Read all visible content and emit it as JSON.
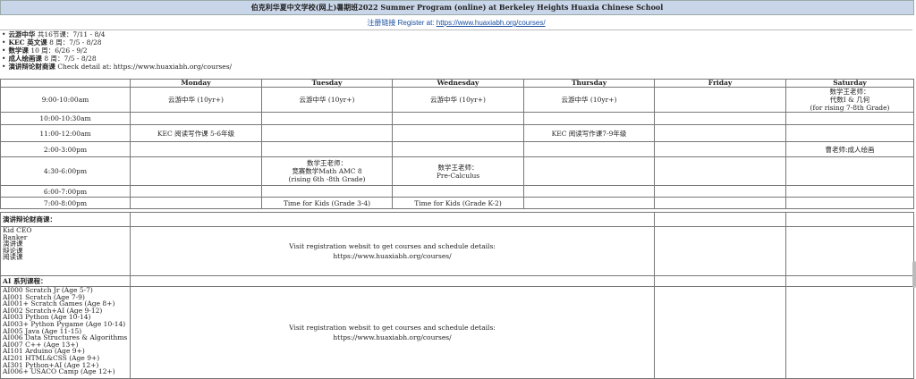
{
  "header": {
    "title": "伯克利华夏中文学校(网上)暑期班2022 Summer Program (online) at Berkeley Heights Huaxia Chinese School"
  },
  "register": {
    "label": "注册链接 Register at: ",
    "url": "https://www.huaxiabh.org/courses/"
  },
  "bullets": [
    {
      "name": "云游中华",
      "rest": " 共16节课：7/11 - 8/4"
    },
    {
      "name": "KEC 英文课",
      "rest": " 8 周：7/5 - 8/28"
    },
    {
      "name": "数学课",
      "rest": " 10 周：6/26 - 9/2"
    },
    {
      "name": "成人绘画课",
      "rest": " 8 周：7/5 - 8/28"
    },
    {
      "name": "演讲辩论财商课",
      "rest": " Check detail at: https://www.huaxiabh.org/courses/"
    }
  ],
  "days": [
    "Monday",
    "Tuesday",
    "Wednesday",
    "Thursday",
    "Friday",
    "Saturday"
  ],
  "schedule": [
    {
      "time": "9:00-10:00am",
      "cells": [
        "云游中华 (10yr+)",
        "云游中华 (10yr+)",
        "云游中华 (10yr+)",
        "云游中华 (10yr+)",
        "",
        "数学王老师：\n代数I & 几何\n(for rising 7-8th Grade)"
      ]
    },
    {
      "time": "10:00-10:30am",
      "cells": [
        "",
        "",
        "",
        "",
        "",
        ""
      ]
    },
    {
      "time": "11:00-12:00am",
      "cells": [
        "KEC 阅读写作课 5-6年级",
        "",
        "",
        "KEC 阅读写作课7-9年级",
        "",
        ""
      ]
    },
    {
      "time": "2:00-3:00pm",
      "cells": [
        "",
        "",
        "",
        "",
        "",
        "曹老师:成人绘画"
      ]
    },
    {
      "time": "4:30-6:00pm",
      "cells": [
        "",
        "数学王老师：\n竞赛数学Math AMC 8\n(rising 6th -8th Grade)",
        "数学王老师：\nPre-Calculus",
        "",
        "",
        ""
      ]
    },
    {
      "time": "6:00-7:00pm",
      "cells": [
        "",
        "",
        "",
        "",
        "",
        ""
      ]
    },
    {
      "time": "7:00-8:00pm",
      "cells": [
        "",
        "Time for Kids (Grade 3-4)",
        "Time for Kids (Grade K-2)",
        "",
        "",
        ""
      ]
    }
  ],
  "speech": {
    "heading": "演讲辩论财商课：",
    "items": [
      "Kid CEO",
      "Banker",
      "演讲课",
      "辩论课",
      "阅读课"
    ],
    "notice_line1": "Visit registration websit to get courses and schedule details:",
    "notice_line2": "https://www.huaxiabh.org/courses/"
  },
  "ai": {
    "heading": "AI 系列课程：",
    "items": [
      "AI000 Scratch Jr (Age 5-7)",
      "AI001 Scratch (Age 7-9)",
      "AI001+ Scratch Games (Age 8+)",
      "AI002 Scratch+AI (Age 9-12)",
      "AI003 Python (Age 10-14)",
      "AI003+ Python Pygame (Age 10-14)",
      "AI005 Java (Age 11-15)",
      "AI006 Data Structures & Algorithms",
      "AI007 C++ (Age 13+)",
      "AI101 Arduino (Age 9+)",
      "AI201 HTML&CSS (Age 9+)",
      "AI301 Python+AI (Age 12+)",
      "AI006+ USACO Camp (Age 12+)"
    ],
    "notice_line1": "Visit registration websit to get courses and schedule details:",
    "notice_line2": "https://www.huaxiabh.org/courses/"
  }
}
